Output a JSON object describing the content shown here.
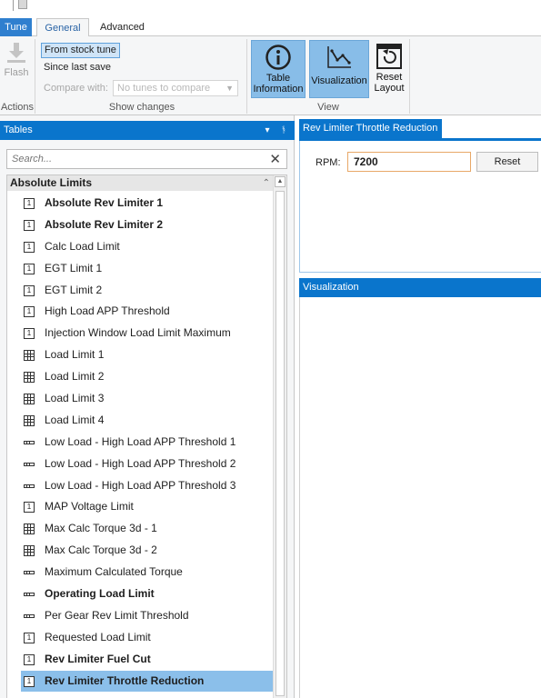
{
  "tabs": {
    "tune": "Tune",
    "general": "General",
    "advanced": "Advanced"
  },
  "ribbon": {
    "actions": {
      "flash_label": "Flash",
      "group_label": "Actions"
    },
    "show_changes": {
      "options": [
        "From stock tune",
        "Since last save"
      ],
      "selected_option": "From stock tune",
      "compare_label": "Compare with:",
      "compare_placeholder": "No tunes to compare",
      "group_label": "Show changes"
    },
    "view": {
      "table_information_line1": "Table",
      "table_information_line2": "Information",
      "visualization_label": "Visualization",
      "reset_layout_line1": "Reset",
      "reset_layout_line2": "Layout",
      "group_label": "View"
    }
  },
  "tables_panel": {
    "title": "Tables",
    "search_placeholder": "Search...",
    "group_name": "Absolute Limits",
    "items": [
      {
        "label": "Absolute Rev Limiter 1",
        "icon": "scalar-icon",
        "bold": true
      },
      {
        "label": "Absolute Rev Limiter 2",
        "icon": "scalar-icon",
        "bold": true
      },
      {
        "label": "Calc Load Limit",
        "icon": "scalar-icon",
        "bold": false
      },
      {
        "label": "EGT Limit 1",
        "icon": "scalar-icon",
        "bold": false
      },
      {
        "label": "EGT Limit 2",
        "icon": "scalar-icon",
        "bold": false
      },
      {
        "label": "High Load APP Threshold",
        "icon": "scalar-icon",
        "bold": false
      },
      {
        "label": "Injection Window Load Limit Maximum",
        "icon": "scalar-icon",
        "bold": false
      },
      {
        "label": "Load Limit 1",
        "icon": "table-2d-icon",
        "bold": false
      },
      {
        "label": "Load Limit 2",
        "icon": "table-2d-icon",
        "bold": false
      },
      {
        "label": "Load Limit 3",
        "icon": "table-2d-icon",
        "bold": false
      },
      {
        "label": "Load Limit 4",
        "icon": "table-2d-icon",
        "bold": false
      },
      {
        "label": "Low Load - High Load APP Threshold 1",
        "icon": "table-1d-icon",
        "bold": false
      },
      {
        "label": "Low Load - High Load APP Threshold 2",
        "icon": "table-1d-icon",
        "bold": false
      },
      {
        "label": "Low Load - High Load APP Threshold 3",
        "icon": "table-1d-icon",
        "bold": false
      },
      {
        "label": "MAP Voltage Limit",
        "icon": "scalar-icon",
        "bold": false
      },
      {
        "label": "Max Calc Torque 3d - 1",
        "icon": "table-2d-icon",
        "bold": false
      },
      {
        "label": "Max Calc Torque 3d - 2",
        "icon": "table-2d-icon",
        "bold": false
      },
      {
        "label": "Maximum Calculated Torque",
        "icon": "table-1d-icon",
        "bold": false
      },
      {
        "label": "Operating Load Limit",
        "icon": "table-1d-icon",
        "bold": true
      },
      {
        "label": "Per Gear Rev Limit Threshold",
        "icon": "table-1d-icon",
        "bold": false
      },
      {
        "label": "Requested Load Limit",
        "icon": "scalar-icon",
        "bold": false
      },
      {
        "label": "Rev Limiter Fuel Cut",
        "icon": "scalar-icon",
        "bold": true
      },
      {
        "label": "Rev Limiter Throttle Reduction",
        "icon": "scalar-icon",
        "bold": true,
        "selected": true
      }
    ]
  },
  "editor": {
    "tab_title": "Rev Limiter Throttle Reduction",
    "rpm_label": "RPM:",
    "rpm_value": "7200",
    "reset_label": "Reset"
  },
  "visualization": {
    "title": "Visualization"
  },
  "colors": {
    "accent_blue": "#0a75cc",
    "selected_row": "#8bbfea",
    "active_button": "#88bde8"
  }
}
